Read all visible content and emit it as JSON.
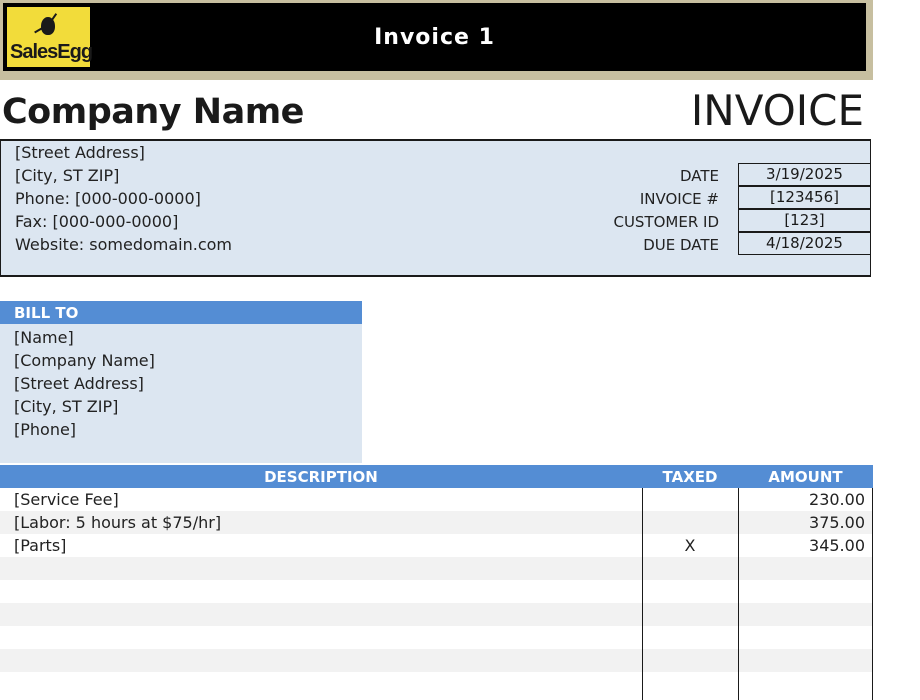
{
  "banner": {
    "logo_text": "SalesEgg",
    "title": "Invoice 1"
  },
  "heading": {
    "company_name": "Company Name",
    "document_type": "INVOICE"
  },
  "company_info": {
    "street": "[Street Address]",
    "city": "[City, ST  ZIP]",
    "phone": "Phone: [000-000-0000]",
    "fax": "Fax: [000-000-0000]",
    "website": "Website: somedomain.com"
  },
  "meta": {
    "date_label": "DATE",
    "date_value": "3/19/2025",
    "invoice_label": "INVOICE #",
    "invoice_value": "[123456]",
    "customer_label": "CUSTOMER ID",
    "customer_value": "[123]",
    "due_label": "DUE DATE",
    "due_value": "4/18/2025"
  },
  "bill_to": {
    "header": "BILL TO",
    "name": "[Name]",
    "company": "[Company Name]",
    "street": "[Street Address]",
    "city": "[City, ST  ZIP]",
    "phone": "[Phone]"
  },
  "items": {
    "headers": {
      "description": "DESCRIPTION",
      "taxed": "TAXED",
      "amount": "AMOUNT"
    },
    "rows": [
      {
        "description": "[Service Fee]",
        "taxed": "",
        "amount": "230.00"
      },
      {
        "description": "[Labor: 5 hours at $75/hr]",
        "taxed": "",
        "amount": "375.00"
      },
      {
        "description": "[Parts]",
        "taxed": "X",
        "amount": "345.00"
      },
      {
        "description": "",
        "taxed": "",
        "amount": ""
      },
      {
        "description": "",
        "taxed": "",
        "amount": ""
      },
      {
        "description": "",
        "taxed": "",
        "amount": ""
      },
      {
        "description": "",
        "taxed": "",
        "amount": ""
      },
      {
        "description": "",
        "taxed": "",
        "amount": ""
      },
      {
        "description": "",
        "taxed": "",
        "amount": ""
      }
    ]
  },
  "colors": {
    "header_blue": "#548dd4",
    "panel_blue": "#dce6f1",
    "banner_black": "#000000",
    "logo_yellow": "#f2dc3a"
  }
}
